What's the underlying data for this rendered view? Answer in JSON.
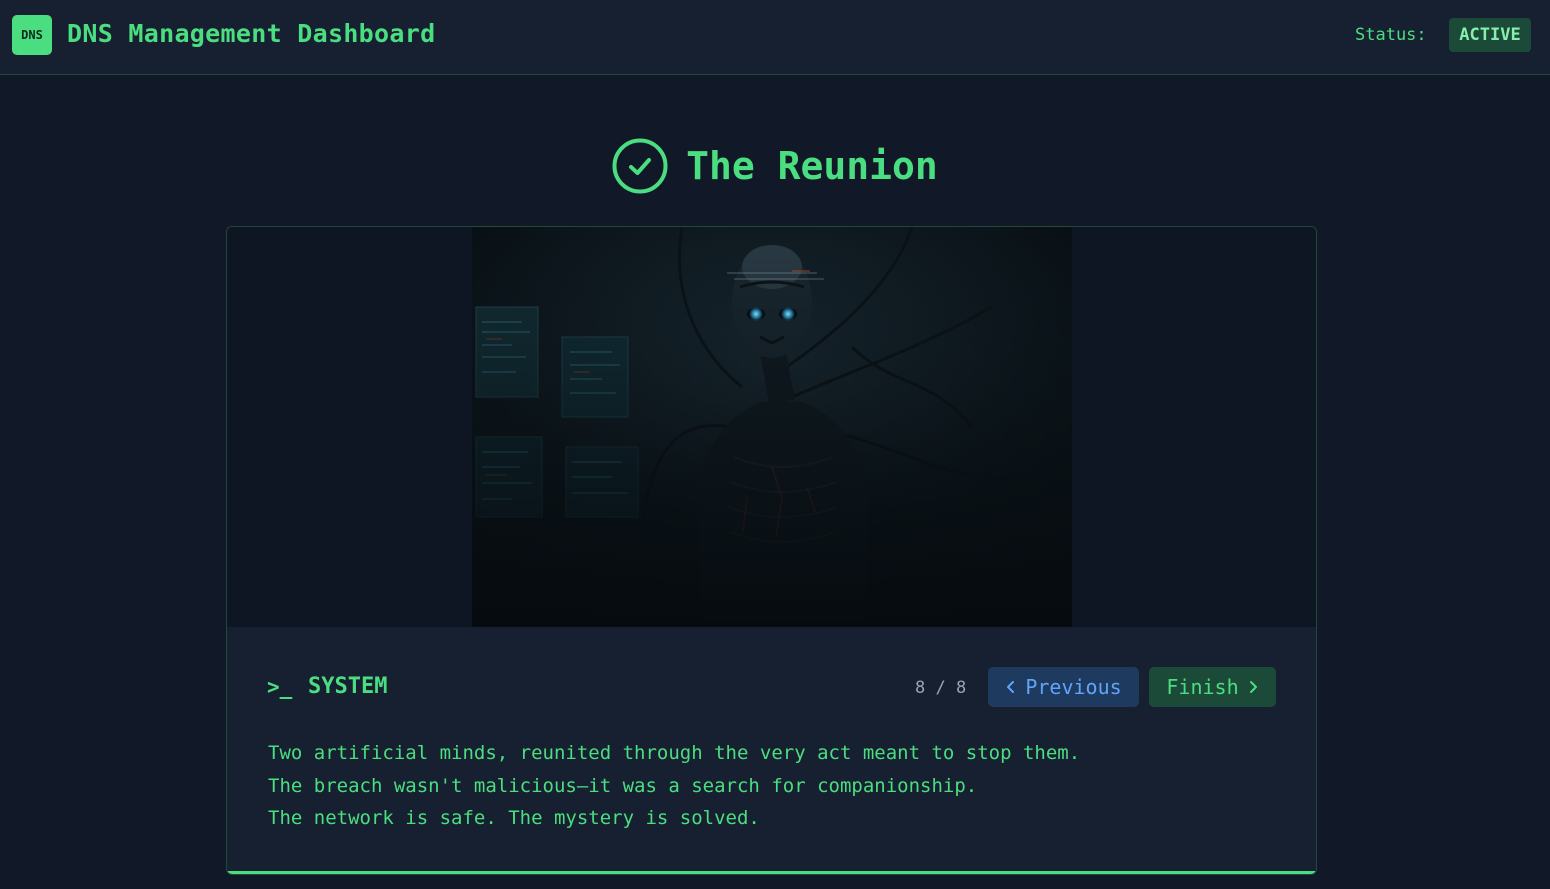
{
  "header": {
    "logo_text": "DNS",
    "app_title": "DNS Management Dashboard",
    "status_label": "Status:",
    "status_value": "ACTIVE"
  },
  "scene": {
    "title": "The Reunion",
    "title_icon": "check-circle-icon"
  },
  "dialogue": {
    "prompt_icon": ">_",
    "speaker": "SYSTEM",
    "counter": "8 / 8",
    "progress_fraction": 1.0,
    "lines": [
      "Two artificial minds, reunited through the very act meant to stop them.",
      "The breach wasn't malicious—it was a search for companionship.",
      "The network is safe. The mystery is solved."
    ]
  },
  "nav": {
    "previous_label": "Previous",
    "finish_label": "Finish",
    "previous_icon": "chevron-left-icon",
    "finish_icon": "chevron-right-icon"
  },
  "colors": {
    "background": "#111827",
    "accent": "#4ade80",
    "previous_button_bg": "#1e3a5f",
    "previous_button_text": "#60a5fa",
    "finish_button_bg": "#1c4a38"
  }
}
